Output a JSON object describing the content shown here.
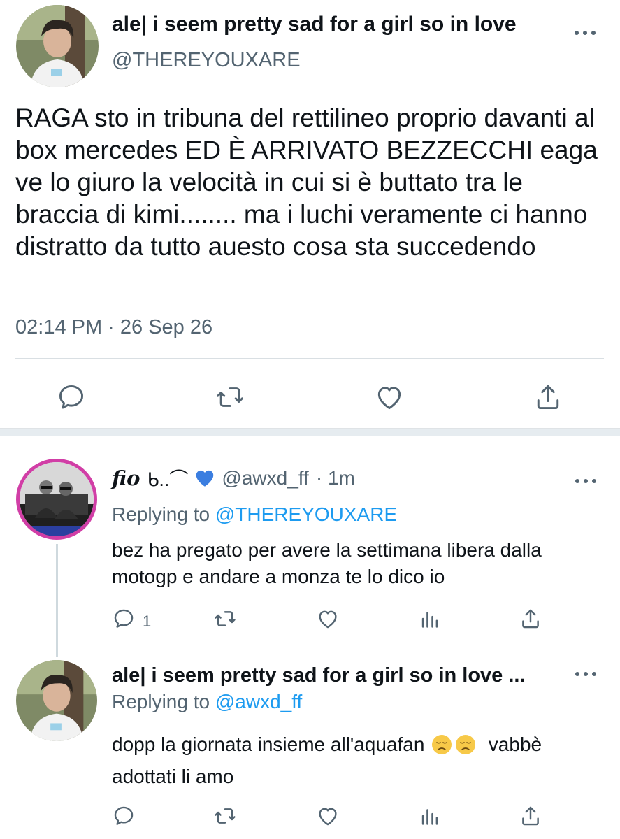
{
  "main_tweet": {
    "display_name": "ale| i seem pretty sad for a girl so in love",
    "handle": "@THEREYOUXARE",
    "text": "RAGA sto in tribuna del rettilineo proprio davanti al box mercedes ED È ARRIVATO BEZZECCHI eaga ve lo giuro la velocità in cui si è buttato tra le braccia di kimi........ ma i luchi veramente ci hanno distratto da tutto auesto cosa sta succedendo",
    "timestamp": "02:14 PM · 26 Sep 26",
    "actions": [
      "reply-icon",
      "retweet-icon",
      "like-icon",
      "share-icon"
    ]
  },
  "replies": [
    {
      "display_name": "fio",
      "name_glyphs": "ᑲ..⌒",
      "name_emoji": "blue-heart-icon",
      "handle": "@awxd_ff",
      "time": "· 1m",
      "replying_prefix": "Replying to",
      "replying_to": "@THEREYOUXARE",
      "text": "bez ha pregato per avere la settimana libera dalla motogp e andare a monza te lo dico io",
      "reply_count": "1",
      "actions": [
        "reply-icon",
        "retweet-icon",
        "like-icon",
        "analytics-icon",
        "share-icon"
      ]
    },
    {
      "display_name": "ale| i seem pretty sad for a girl so in love ...",
      "replying_prefix": "Replying to",
      "replying_to": "@awxd_ff",
      "text_before_emoji": "dopp la giornata insieme all'aquafan",
      "emoji": [
        "disappointed-face-icon",
        "disappointed-face-icon"
      ],
      "text_after_emoji": "vabbè",
      "text_line2": "adottati li amo",
      "actions": [
        "reply-icon",
        "retweet-icon",
        "like-icon",
        "analytics-icon",
        "share-icon"
      ]
    }
  ],
  "colors": {
    "text": "#0f1419",
    "secondary": "#536471",
    "link": "#1d9bf0",
    "separator": "#e6ecf0",
    "avatar_ring": "#d13ea6"
  }
}
